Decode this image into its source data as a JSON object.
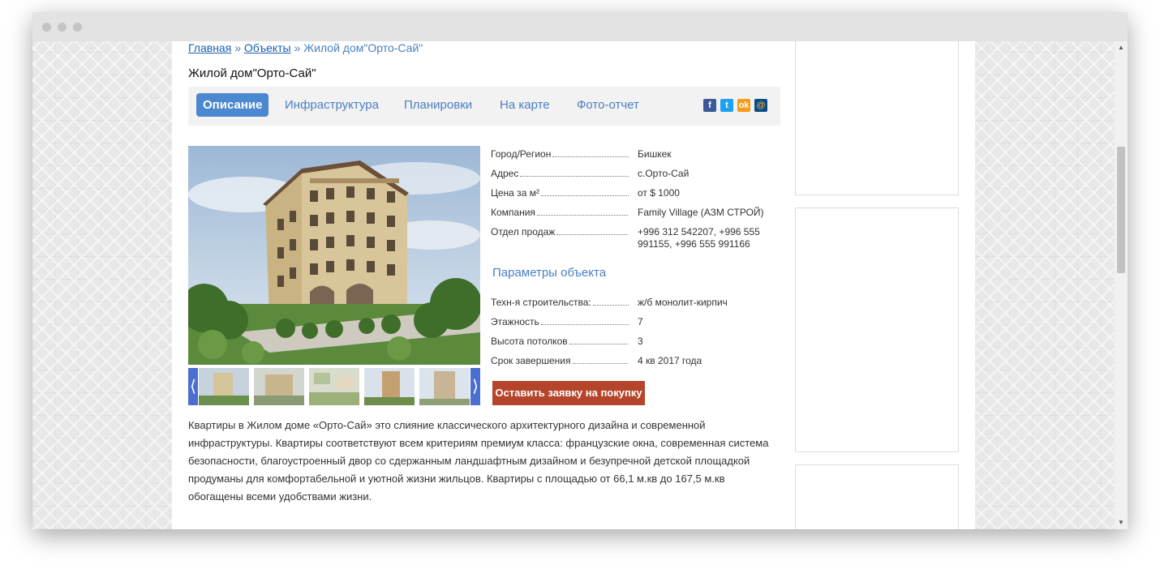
{
  "breadcrumb": {
    "home": "Главная",
    "sep1": "»",
    "objects": "Объекты",
    "sep2": "»",
    "current": "Жилой дом\"Орто-Сай\""
  },
  "page_title": "Жилой дом\"Орто-Сай\"",
  "tabs": [
    {
      "label": "Описание",
      "active": true
    },
    {
      "label": "Инфраструктура",
      "active": false
    },
    {
      "label": "Планировки",
      "active": false
    },
    {
      "label": "На карте",
      "active": false
    },
    {
      "label": "Фото-отчет",
      "active": false
    }
  ],
  "share": {
    "facebook": "f",
    "twitter": "t",
    "odnoklassniki": "ok",
    "mail": "@"
  },
  "specs": [
    {
      "label": "Город/Регион",
      "value": "Бишкек"
    },
    {
      "label": "Адрес",
      "value": "с.Орто-Сай"
    },
    {
      "label": "Цена за м²",
      "value": "от $ 1000"
    },
    {
      "label": "Компания",
      "value": "Family Village (АЗМ СТРОЙ)"
    },
    {
      "label": "Отдел продаж",
      "value": "+996 312 542207, +996 555 991155, +996 555 991166"
    }
  ],
  "params_title": "Параметры объекта",
  "params": [
    {
      "label": "Техн-я строительства:",
      "value": "ж/б монолит-кирпич"
    },
    {
      "label": "Этажность",
      "value": "7"
    },
    {
      "label": "Высота потолков",
      "value": "3"
    },
    {
      "label": "Срок завершения",
      "value": "4 кв 2017 года"
    }
  ],
  "buy_button": "Оставить заявку на покупку",
  "thumb_prev": "⟨",
  "thumb_next": "⟩",
  "description": "Квартиры в Жилом доме «Орто-Сай» это слияние классического архитектурного дизайна и современной инфраструктуры. Квартиры соответствуют всем критериям премиум класса: французские окна, современная система безопасности, благоустроенный двор со сдержанным ландшафтным дизайном и безупречной детской площадкой продуманы для комфортабельной и уютной жизни жильцов. Квартиры с площадью от 66,1 м.кв до 167,5 м.кв обогащены всеми удобствами жизни.",
  "colors": {
    "accent": "#4a88d0",
    "link": "#4a7fc1",
    "buy_button": "#b5452a",
    "thumb_nav": "#4a6fd0"
  }
}
